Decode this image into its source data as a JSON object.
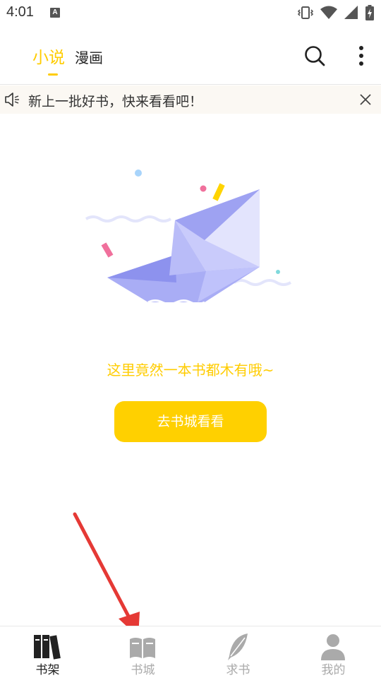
{
  "status_bar": {
    "time": "4:01",
    "badge": "A",
    "icons": [
      "vibrate-icon",
      "wifi-icon",
      "signal-icon",
      "battery-icon"
    ]
  },
  "header": {
    "tabs": [
      {
        "label": "小说",
        "active": true
      },
      {
        "label": "漫画",
        "active": false
      }
    ],
    "actions": [
      "search-icon",
      "more-vertical-icon"
    ],
    "accent_color": "#ffcc00"
  },
  "notice": {
    "text": "新上一批好书，快来看看吧！",
    "icons": [
      "speaker-icon",
      "close-icon"
    ]
  },
  "empty_state": {
    "message": "这里竟然一本书都木有哦~",
    "button_label": "去书城看看",
    "button_color": "#ffd000"
  },
  "bottom_nav": {
    "items": [
      {
        "label": "书架",
        "icon": "bookshelf-icon",
        "active": true
      },
      {
        "label": "书城",
        "icon": "open-book-icon",
        "active": false
      },
      {
        "label": "求书",
        "icon": "feather-icon",
        "active": false
      },
      {
        "label": "我的",
        "icon": "person-icon",
        "active": false
      }
    ]
  },
  "annotation": {
    "color": "#e53935"
  }
}
